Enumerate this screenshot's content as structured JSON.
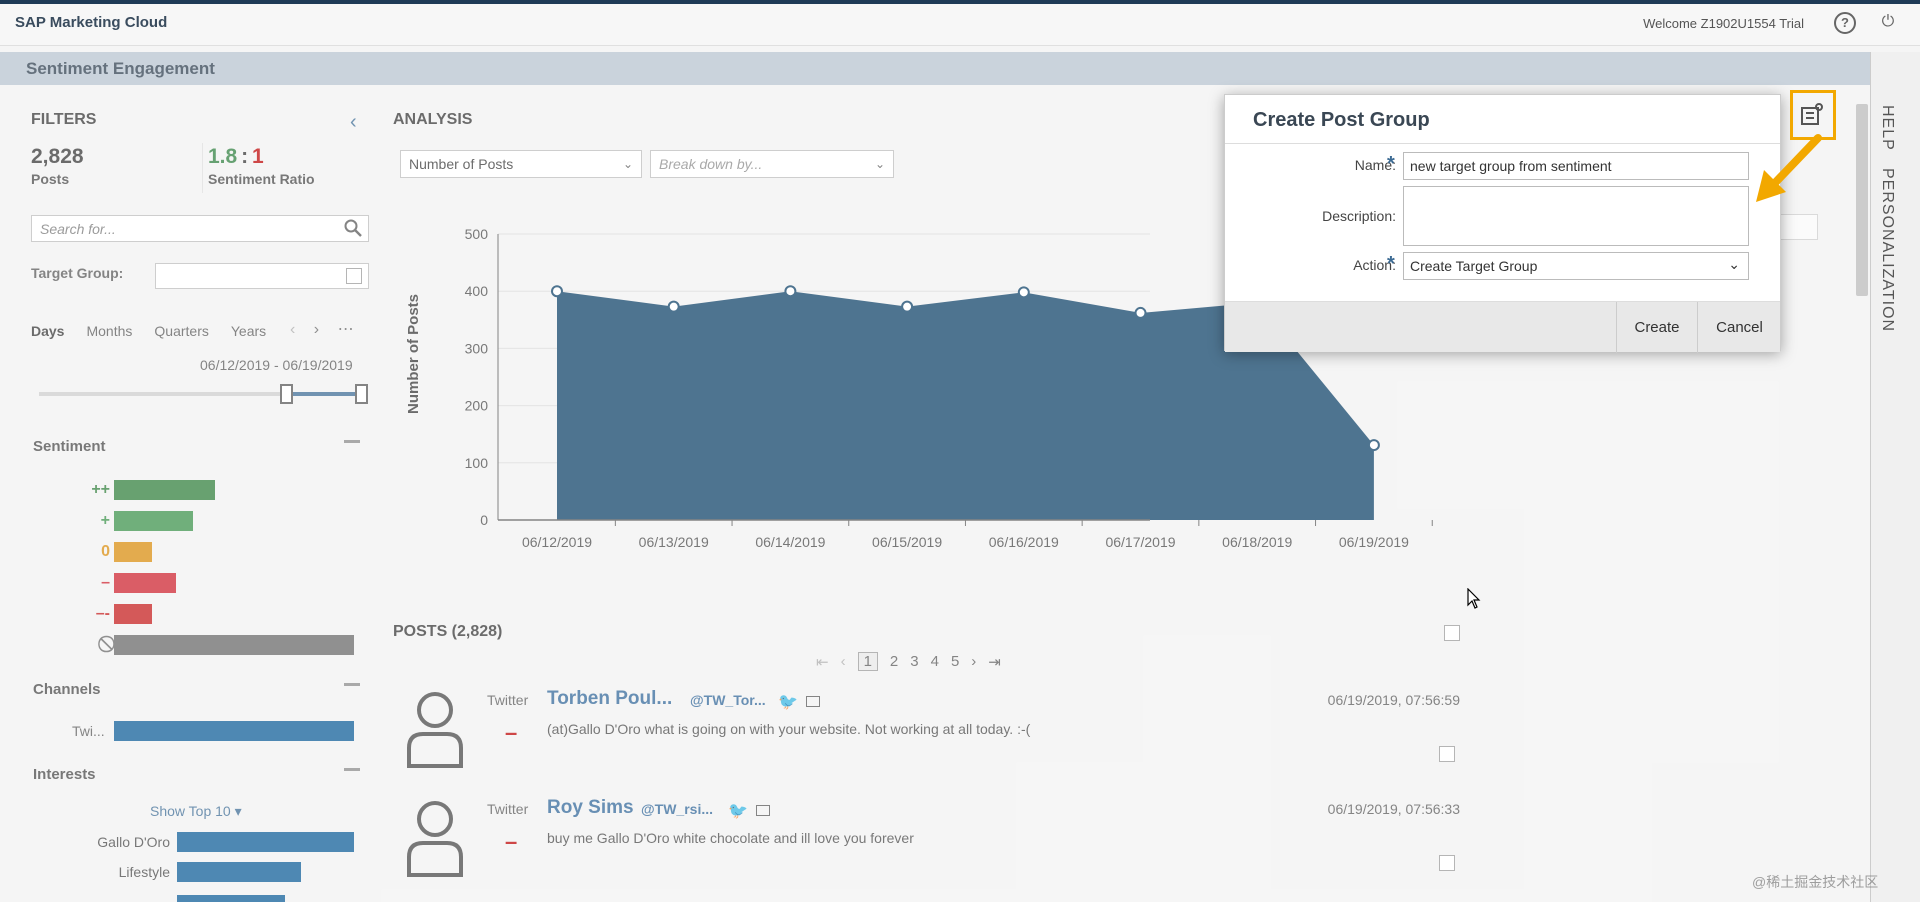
{
  "shell": {
    "brand": "SAP Marketing Cloud",
    "welcome": "Welcome Z1902U1554 Trial",
    "help_icon": "?",
    "power_icon": "⏻"
  },
  "page": {
    "title": "Sentiment Engagement"
  },
  "filters": {
    "title": "FILTERS",
    "posts_count": "2,828",
    "posts_label": "Posts",
    "ratio_positive": "1.8",
    "ratio_colon": ":",
    "ratio_negative": "1",
    "ratio_label": "Sentiment Ratio",
    "search_placeholder": "Search for...",
    "target_group_label": "Target Group:",
    "periods": [
      "Days",
      "Months",
      "Quarters",
      "Years"
    ],
    "active_period": "Days",
    "date_from": "06/12/2019",
    "date_sep": " - ",
    "date_to": "06/19/2019",
    "sentiment_title": "Sentiment",
    "sentiment_rows": [
      {
        "label": "++",
        "color": "#2e7d3a",
        "level": 0.42
      },
      {
        "label": "+",
        "color": "#3a9149",
        "level": 0.33
      },
      {
        "label": "0",
        "color": "#d88b0a",
        "level": 0.16
      },
      {
        "label": "–",
        "color": "#cc1f2c",
        "level": 0.26
      },
      {
        "label": "–-",
        "color": "#c41a1a",
        "level": 0.16
      },
      {
        "label": "⃠",
        "color": "#666666",
        "level": 1.0
      }
    ],
    "channels_title": "Channels",
    "channel_label": "Twi...",
    "interests_title": "Interests",
    "show_top": "Show Top 10 ▾",
    "interests": [
      {
        "label": "Gallo D'Oro",
        "level": 1.0
      },
      {
        "label": "Lifestyle",
        "level": 0.7
      }
    ]
  },
  "analysis": {
    "title": "ANALYSIS",
    "measure_select": "Number of Posts",
    "breakdown_placeholder": "Break down by...",
    "ylabel": "Number of Posts"
  },
  "chart_data": {
    "type": "area",
    "x": [
      "06/12/2019",
      "06/13/2019",
      "06/14/2019",
      "06/15/2019",
      "06/16/2019",
      "06/17/2019",
      "06/18/2019",
      "06/19/2019"
    ],
    "values": [
      400,
      373,
      400,
      373,
      398,
      362,
      380,
      131
    ],
    "ylim": [
      0,
      500
    ],
    "yticks": [
      "0",
      "100",
      "200",
      "300",
      "400",
      "500"
    ],
    "ylabel": "Number of Posts",
    "color": "#0b3f66",
    "grid": true
  },
  "posts": {
    "title": "POSTS (2,828)",
    "pages": [
      "1",
      "2",
      "3",
      "4",
      "5"
    ],
    "current_page": "1",
    "items": [
      {
        "source": "Twitter",
        "name": "Torben Poul...",
        "handle": "@TW_Tor...",
        "date": "06/19/2019, 07:56:59",
        "text": "(at)Gallo D'Oro what is going on with your website. Not working at all today. :-(",
        "sentiment": "–"
      },
      {
        "source": "Twitter",
        "name": "Roy Sims",
        "handle": "@TW_rsi...",
        "date": "06/19/2019, 07:56:33",
        "text": "buy me Gallo D'Oro white chocolate and ill love you forever",
        "sentiment": "–"
      }
    ]
  },
  "right_rail": {
    "help": "HELP",
    "personalization": "PERSONALIZATION"
  },
  "dialog": {
    "title": "Create Post Group",
    "name_label": "Name:",
    "name_value": "new target group from sentiment",
    "description_label": "Description:",
    "description_value": "",
    "action_label": "Action:",
    "action_value": "Create Target Group",
    "create_label": "Create",
    "cancel_label": "Cancel"
  },
  "watermark": "@稀土掘金技术社区"
}
